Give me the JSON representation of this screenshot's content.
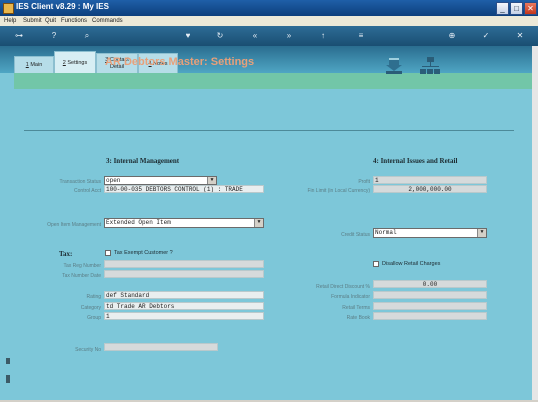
{
  "window": {
    "title": "IES Client v8.29 : My IES"
  },
  "menu": [
    "Help",
    "Submit",
    "Quit",
    "Functions",
    "Commands"
  ],
  "tabs": [
    {
      "num": "1",
      "label": "Main"
    },
    {
      "num": "2",
      "label": "Settings"
    },
    {
      "num": "3",
      "label": "Contact",
      "label2": "Detail"
    },
    {
      "num": "4",
      "label": "Notes"
    }
  ],
  "form_title": "AR Debtors Master: Settings",
  "left_section": "3: Internal Management",
  "right_section": "4: Internal Issues and Retail",
  "fields": {
    "transaction_status": {
      "label": "Transaction Status",
      "value": "open"
    },
    "control_acct": {
      "label": "Control Acct",
      "value": "100-00-035 DEBTORS CONTROL (1) : TRADE"
    },
    "open_item_mgmt": {
      "label": "Open Item Management",
      "value": "Extended Open Item"
    },
    "profit": {
      "label": "Profit",
      "value": "1"
    },
    "fin_limit": {
      "label": "Fin Limit (in Local Currency)",
      "value": "2,000,000.00"
    },
    "credit_status": {
      "label": "Credit Status",
      "value": "Normal"
    },
    "disallow_retail": {
      "label": "Disallow Retail Charges"
    },
    "retail_direct_discount": {
      "label": "Retail Direct Discount %",
      "value": "0.00"
    },
    "formula_indicator": {
      "label": "Formula Indicator",
      "value": ""
    },
    "retail_terms": {
      "label": "Retail Terms",
      "value": ""
    },
    "rate_book": {
      "label": "Rate Book",
      "value": ""
    },
    "tax_heading": "Tax:",
    "tax_exempt": {
      "label": "Tax Exempt Customer ?"
    },
    "tax_reg_number": {
      "label": "Tax Reg Number",
      "value": ""
    },
    "tax_number_date": {
      "label": "Tax Number Date",
      "value": ""
    },
    "rating": {
      "label": "Rating",
      "value": "def Standard"
    },
    "category": {
      "label": "Category",
      "value": "td Trade AR Debtors"
    },
    "group": {
      "label": "Group",
      "value": "1"
    },
    "security_no": {
      "label": "Security No",
      "value": ""
    }
  },
  "colors": {
    "content_bg": "#7dc7d9",
    "accent_green": "#72c6a8",
    "title_color": "#e8a07a"
  }
}
